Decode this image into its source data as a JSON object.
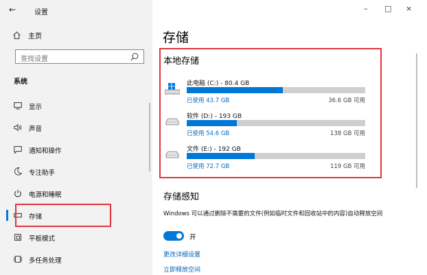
{
  "window": {
    "title": "设置",
    "back_glyph": "←",
    "minimize_glyph": "–",
    "maximize_glyph": "□",
    "close_glyph": "×"
  },
  "sidebar": {
    "home_label": "主页",
    "search_placeholder": "查找设置",
    "section_label": "系统",
    "items": [
      {
        "label": "显示",
        "icon": "monitor-icon"
      },
      {
        "label": "声音",
        "icon": "speaker-icon"
      },
      {
        "label": "通知和操作",
        "icon": "notification-icon"
      },
      {
        "label": "专注助手",
        "icon": "moon-icon"
      },
      {
        "label": "电源和睡眠",
        "icon": "power-icon"
      },
      {
        "label": "存储",
        "icon": "storage-icon",
        "selected": true
      },
      {
        "label": "平板模式",
        "icon": "tablet-icon"
      },
      {
        "label": "多任务处理",
        "icon": "multitask-icon"
      }
    ]
  },
  "main": {
    "title": "存储",
    "local_storage_title": "本地存储",
    "drives": [
      {
        "name": "此电脑 (C:) - 80.4 GB",
        "used": "已使用 43.7 GB",
        "free": "36.6 GB 可用",
        "used_fraction": 0.54,
        "icon": "windows-drive-icon"
      },
      {
        "name": "软件 (D:) - 193 GB",
        "used": "已使用 54.6 GB",
        "free": "138 GB 可用",
        "used_fraction": 0.28,
        "icon": "hard-drive-icon"
      },
      {
        "name": "文件 (E:) - 192 GB",
        "used": "已使用 72.7 GB",
        "free": "119 GB 可用",
        "used_fraction": 0.38,
        "icon": "hard-drive-icon"
      }
    ],
    "storage_sense_title": "存储感知",
    "storage_sense_desc": "Windows 可以通过删除不需要的文件(例如临时文件和回收站中的内容)自动释放空间",
    "toggle_label": "开",
    "toggle_on": true,
    "link_configure": "更改详细设置",
    "link_free_now": "立即释放空间"
  },
  "colors": {
    "accent": "#0078d7",
    "highlight": "#e0343a",
    "sidebar_bg": "#f2f2f2"
  }
}
